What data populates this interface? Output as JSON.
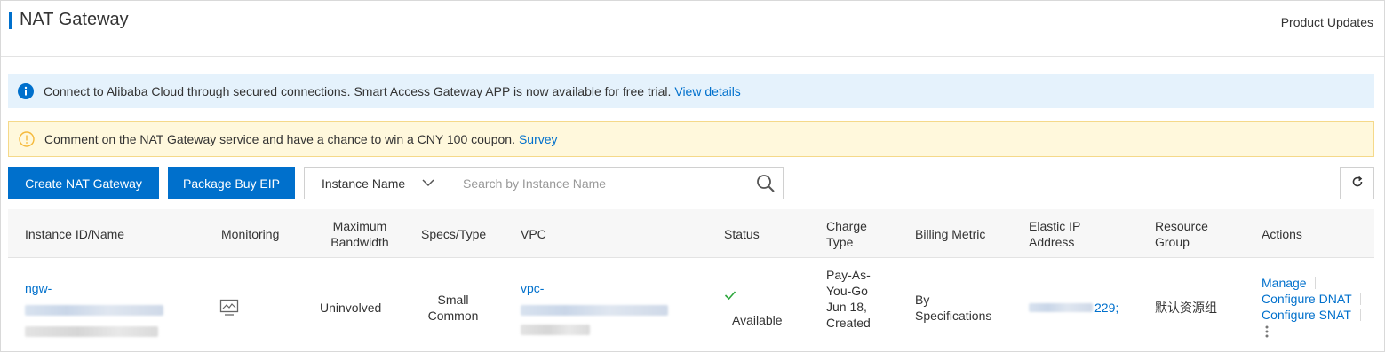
{
  "header": {
    "title": "NAT Gateway",
    "product_updates": "Product Updates"
  },
  "banners": {
    "info_text": "Connect to Alibaba Cloud through secured connections. Smart Access Gateway APP is now available for free trial.",
    "info_link": "View details",
    "warn_text": "Comment on the NAT Gateway service and have a chance to win a CNY 100 coupon.",
    "warn_link": "Survey"
  },
  "toolbar": {
    "create_label": "Create NAT Gateway",
    "package_label": "Package Buy EIP",
    "filter_select": "Instance Name",
    "search_placeholder": "Search by Instance Name"
  },
  "table": {
    "columns": {
      "instance": "Instance ID/Name",
      "monitoring": "Monitoring",
      "bandwidth": "Maximum Bandwidth",
      "specs": "Specs/Type",
      "vpc": "VPC",
      "status": "Status",
      "charge": "Charge Type",
      "billing": "Billing Metric",
      "eip": "Elastic IP Address",
      "resource": "Resource Group",
      "actions": "Actions"
    },
    "rows": [
      {
        "instance_prefix": "ngw-",
        "bandwidth": "Uninvolved",
        "specs": "Small Common",
        "vpc_prefix": "vpc-",
        "status": "Available",
        "charge": "Pay-As-You-Go Jun 18, Created",
        "billing": "By Specifications",
        "eip_suffix": "229;",
        "resource_group": "默认资源组",
        "actions": {
          "manage": "Manage",
          "dnat": "Configure DNAT",
          "snat": "Configure SNAT"
        }
      }
    ]
  },
  "colors": {
    "accent": "#0070cc",
    "success": "#2ca73c",
    "info_bg": "#e5f2fc",
    "warn_bg": "#fff8dc"
  }
}
